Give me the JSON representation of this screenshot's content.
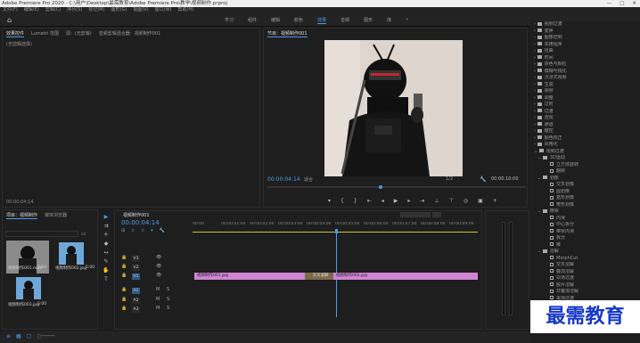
{
  "window": {
    "title": "Adobe Premiere Pro 2020 - C:\\用户\\Desktop\\最需教育\\Adobe Premiere Pro\\教学\\视频制作.prproj",
    "min": "—",
    "max": "□",
    "close": "✕"
  },
  "menu": [
    "文件(F)",
    "编辑(E)",
    "剪辑(C)",
    "序列(S)",
    "标记(M)",
    "图形(G)",
    "视图(V)",
    "窗口(W)",
    "帮助(H)"
  ],
  "workspaces": [
    "学习",
    "组件",
    "编辑",
    "颜色",
    "效果",
    "音频",
    "图形",
    "库",
    "»"
  ],
  "active_workspace": "效果",
  "source_panel": {
    "tabs": [
      "效果控件",
      "Lumetri 范围",
      "源：(无剪辑)",
      "音频剪辑混合器：视频制作001"
    ],
    "no_clip": "(无剪辑选择)",
    "timecode": "00:00:04:14"
  },
  "program_panel": {
    "tab": "节目：视频制作001",
    "timecode_left": "00:00:04:14",
    "fit": "适合",
    "fraction": "1/2",
    "timecode_right": "00:00:10:00"
  },
  "project_panel": {
    "tabs": [
      "项目：视频制作",
      "媒体浏览器"
    ],
    "items": [
      {
        "name": "视频制作001.mp4",
        "duration": "5:00"
      },
      {
        "name": "视频制作002.jpg",
        "duration": "5:00"
      },
      {
        "name": "视频制作003.jpg",
        "duration": "5:00"
      }
    ]
  },
  "timeline": {
    "tab": "视频制作001",
    "timecode": "00:00:04:14",
    "ruler": [
      "00:00",
      "00:00:01:00",
      "00:00:02:00",
      "00:00:03:00",
      "00:00:04:00",
      "00:00:05:00",
      "00:00:06:00",
      "00:00:07:00",
      "00:00:08:00",
      "00:00:09:00"
    ],
    "tracks": [
      "V3",
      "V2",
      "V1",
      "A1",
      "A2",
      "A3"
    ],
    "clips": [
      {
        "label": "视频制作001.jpg"
      },
      {
        "label": "交叉溶解"
      },
      {
        "label": "视频制作002.jpg"
      }
    ]
  },
  "effects_tree": {
    "items": [
      {
        "label": "视频过渡",
        "type": "folder"
      },
      {
        "label": "变换",
        "type": "folder"
      },
      {
        "label": "图像控制",
        "type": "folder"
      },
      {
        "label": "实用程序",
        "type": "folder"
      },
      {
        "label": "扭曲",
        "type": "folder"
      },
      {
        "label": "时间",
        "type": "folder"
      },
      {
        "label": "杂色与颗粒",
        "type": "folder"
      },
      {
        "label": "模糊与锐化",
        "type": "folder"
      },
      {
        "label": "沉浸式视频",
        "type": "folder"
      },
      {
        "label": "生成",
        "type": "folder"
      },
      {
        "label": "视频",
        "type": "folder"
      },
      {
        "label": "调整",
        "type": "folder"
      },
      {
        "label": "过时",
        "type": "folder"
      },
      {
        "label": "过渡",
        "type": "folder"
      },
      {
        "label": "透视",
        "type": "folder"
      },
      {
        "label": "通道",
        "type": "folder"
      },
      {
        "label": "键控",
        "type": "folder"
      },
      {
        "label": "颜色校正",
        "type": "folder"
      },
      {
        "label": "风格化",
        "type": "folder"
      },
      {
        "label": "视频过渡",
        "type": "folder-open"
      },
      {
        "label": "3D运动",
        "type": "folder-open"
      },
      {
        "label": "立方体旋转",
        "type": "fx"
      },
      {
        "label": "翻转",
        "type": "fx"
      },
      {
        "label": "划像",
        "type": "folder-open"
      },
      {
        "label": "交叉划像",
        "type": "fx"
      },
      {
        "label": "圆划像",
        "type": "fx"
      },
      {
        "label": "盒形划像",
        "type": "fx"
      },
      {
        "label": "菱形划像",
        "type": "fx"
      },
      {
        "label": "擦除",
        "type": "folder-open"
      },
      {
        "label": "内滑",
        "type": "fx"
      },
      {
        "label": "中心拆分",
        "type": "fx"
      },
      {
        "label": "带状内滑",
        "type": "fx"
      },
      {
        "label": "拆分",
        "type": "fx"
      },
      {
        "label": "推",
        "type": "fx"
      },
      {
        "label": "溶解",
        "type": "folder-open"
      },
      {
        "label": "MorphCut",
        "type": "fx"
      },
      {
        "label": "交叉溶解",
        "type": "fx"
      },
      {
        "label": "叠加溶解",
        "type": "fx"
      },
      {
        "label": "白场过渡",
        "type": "fx"
      },
      {
        "label": "胶片溶解",
        "type": "fx"
      },
      {
        "label": "非叠加溶解",
        "type": "fx"
      },
      {
        "label": "黑场过渡",
        "type": "fx"
      }
    ]
  },
  "watermark": "最需教育",
  "colors": {
    "accent": "#4c9be8",
    "clip": "#d084d3",
    "playhead": "#4c9be8"
  }
}
